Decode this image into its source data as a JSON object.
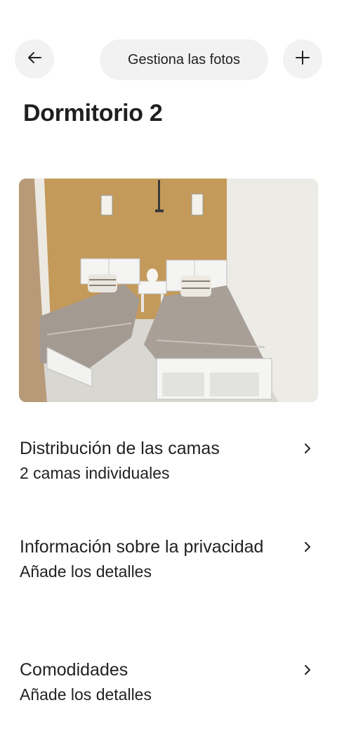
{
  "header": {
    "manage_photos_label": "Gestiona las fotos",
    "back_icon": "arrow-left-icon",
    "add_icon": "plus-icon"
  },
  "page": {
    "title": "Dormitorio 2"
  },
  "sections": [
    {
      "title": "Distribución de las camas",
      "subtitle": "2 camas individuales"
    },
    {
      "title": "Información sobre la privacidad",
      "subtitle": "Añade los detalles"
    },
    {
      "title": "Comodidades",
      "subtitle": "Añade los detalles"
    }
  ],
  "colors": {
    "button_background": "#f2f2f2",
    "text": "#222222"
  }
}
